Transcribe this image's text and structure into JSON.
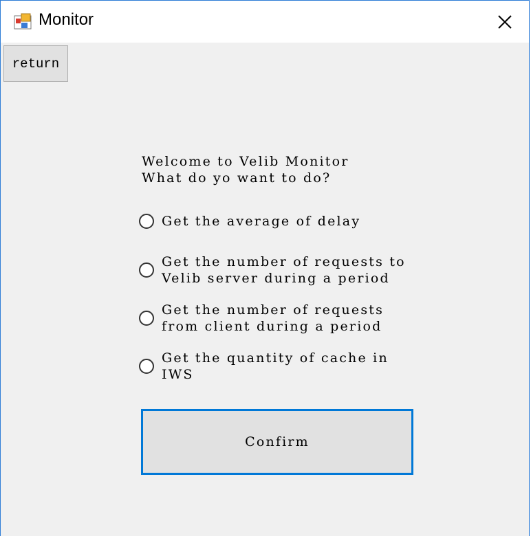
{
  "window": {
    "title": "Monitor",
    "app_icon": "winforms-app-icon",
    "close_icon": "close-icon"
  },
  "toolbar": {
    "return_label": "return"
  },
  "main": {
    "welcome_line1": "Welcome to Velib Monitor",
    "welcome_line2": "What do yo want to do?",
    "options": [
      {
        "line1": "Get the average of delay",
        "line2": "",
        "selected": false
      },
      {
        "line1": "Get the number of requests to",
        "line2": "Velib server during a period",
        "selected": false
      },
      {
        "line1": "Get the number of requests",
        "line2": "from client during a period",
        "selected": false
      },
      {
        "line1": "Get the quantity of cache in",
        "line2": "IWS",
        "selected": false
      }
    ],
    "confirm_label": "Confirm"
  },
  "colors": {
    "accent": "#0078d7",
    "background": "#f0f0f0",
    "button": "#e1e1e1"
  }
}
